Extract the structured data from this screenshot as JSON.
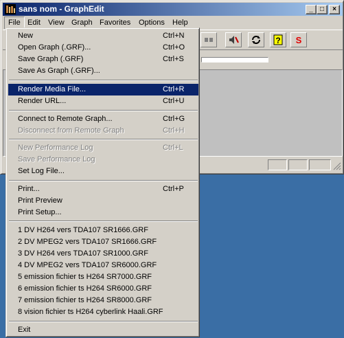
{
  "window": {
    "title": "sans nom - GraphEdit"
  },
  "menubar": [
    "File",
    "Edit",
    "View",
    "Graph",
    "Favorites",
    "Options",
    "Help"
  ],
  "file_menu": {
    "group1": [
      {
        "label": "New",
        "shortcut": "Ctrl+N",
        "enabled": true
      },
      {
        "label": "Open Graph (.GRF)...",
        "shortcut": "Ctrl+O",
        "enabled": true
      },
      {
        "label": "Save Graph (.GRF)",
        "shortcut": "Ctrl+S",
        "enabled": true
      },
      {
        "label": "Save As Graph (.GRF)...",
        "shortcut": "",
        "enabled": true
      }
    ],
    "group2": [
      {
        "label": "Render Media File...",
        "shortcut": "Ctrl+R",
        "enabled": true,
        "selected": true
      },
      {
        "label": "Render URL...",
        "shortcut": "Ctrl+U",
        "enabled": true
      }
    ],
    "group3": [
      {
        "label": "Connect to Remote Graph...",
        "shortcut": "Ctrl+G",
        "enabled": true
      },
      {
        "label": "Disconnect from Remote Graph",
        "shortcut": "Ctrl+H",
        "enabled": false
      }
    ],
    "group4": [
      {
        "label": "New Performance Log",
        "shortcut": "Ctrl+L",
        "enabled": false
      },
      {
        "label": "Save Performance Log",
        "shortcut": "",
        "enabled": false
      },
      {
        "label": "Set Log File...",
        "shortcut": "",
        "enabled": true
      }
    ],
    "group5": [
      {
        "label": "Print...",
        "shortcut": "Ctrl+P",
        "enabled": true
      },
      {
        "label": "Print Preview",
        "shortcut": "",
        "enabled": true
      },
      {
        "label": "Print Setup...",
        "shortcut": "",
        "enabled": true
      }
    ],
    "recent": [
      "1 DV H264 vers TDA107 SR1666.GRF",
      "2 DV MPEG2 vers TDA107 SR1666.GRF",
      "3 DV H264 vers TDA107 SR1000.GRF",
      "4 DV MPEG2 vers TDA107 SR6000.GRF",
      "5 emission fichier ts H264 SR7000.GRF",
      "6 emission fichier ts H264 SR6000.GRF",
      "7 emission fichier ts H264 SR8000.GRF",
      "8 vision fichier ts H264 cyberlink Haali.GRF"
    ],
    "exit": "Exit"
  },
  "toolbar_icons": [
    "disconnect-icon",
    "speaker-icon",
    "refresh-icon",
    "help-icon",
    "seek-icon"
  ],
  "colors": {
    "desktop": "#3a6ea5",
    "titlebar": "#0a246a",
    "highlight": "#0a246a",
    "face": "#d4d0c8"
  }
}
